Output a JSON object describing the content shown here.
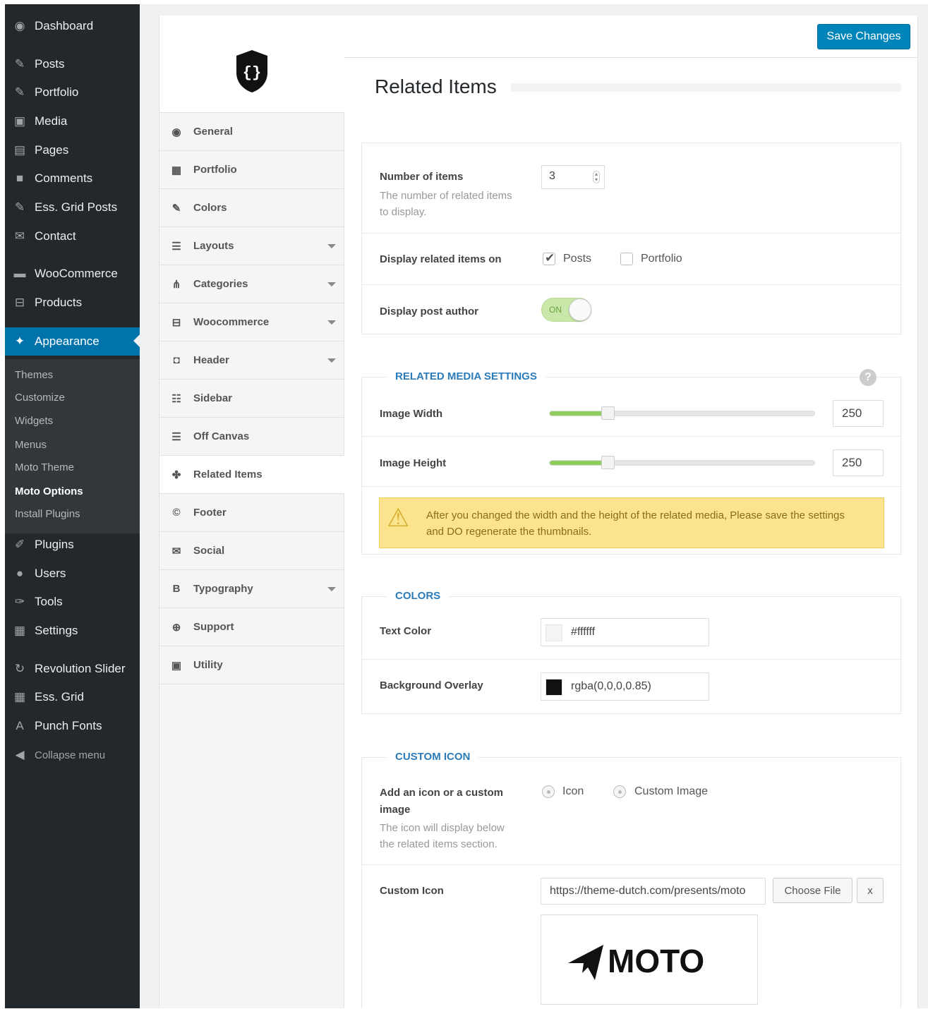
{
  "wp_menu": {
    "items": [
      {
        "label": "Dashboard",
        "icon": "dashboard-icon",
        "glyph": "◉"
      },
      {
        "label": "Posts",
        "icon": "pin-icon",
        "glyph": "✎"
      },
      {
        "label": "Portfolio",
        "icon": "pin-icon",
        "glyph": "✎"
      },
      {
        "label": "Media",
        "icon": "media-icon",
        "glyph": "▣"
      },
      {
        "label": "Pages",
        "icon": "pages-icon",
        "glyph": "▤"
      },
      {
        "label": "Comments",
        "icon": "comments-icon",
        "glyph": "■"
      },
      {
        "label": "Ess. Grid Posts",
        "icon": "pin-icon",
        "glyph": "✎"
      },
      {
        "label": "Contact",
        "icon": "mail-icon",
        "glyph": "✉"
      },
      {
        "label": "WooCommerce",
        "icon": "woo-icon",
        "glyph": "▬"
      },
      {
        "label": "Products",
        "icon": "cart-icon",
        "glyph": "⊟"
      },
      {
        "label": "Appearance",
        "icon": "brush-icon",
        "glyph": "✦"
      },
      {
        "label": "Plugins",
        "icon": "plug-icon",
        "glyph": "✐"
      },
      {
        "label": "Users",
        "icon": "user-icon",
        "glyph": "●"
      },
      {
        "label": "Tools",
        "icon": "wrench-icon",
        "glyph": "✑"
      },
      {
        "label": "Settings",
        "icon": "settings-icon",
        "glyph": "▦"
      },
      {
        "label": "Revolution Slider",
        "icon": "refresh-icon",
        "glyph": "↻"
      },
      {
        "label": "Ess. Grid",
        "icon": "grid-icon",
        "glyph": "▦"
      },
      {
        "label": "Punch Fonts",
        "icon": "font-icon",
        "glyph": "A"
      }
    ],
    "submenu": [
      "Themes",
      "Customize",
      "Widgets",
      "Menus",
      "Moto Theme",
      "Moto Options",
      "Install Plugins"
    ],
    "collapse_label": "Collapse menu"
  },
  "options_nav": {
    "items": [
      {
        "label": "General",
        "glyph": "◉",
        "has_caret": false
      },
      {
        "label": "Portfolio",
        "glyph": "▦",
        "has_caret": false
      },
      {
        "label": "Colors",
        "glyph": "✎",
        "has_caret": false
      },
      {
        "label": "Layouts",
        "glyph": "☰",
        "has_caret": true
      },
      {
        "label": "Categories",
        "glyph": "⋔",
        "has_caret": true
      },
      {
        "label": "Woocommerce",
        "glyph": "⊟",
        "has_caret": true
      },
      {
        "label": "Header",
        "glyph": "◘",
        "has_caret": true
      },
      {
        "label": "Sidebar",
        "glyph": "☷",
        "has_caret": false
      },
      {
        "label": "Off Canvas",
        "glyph": "☰",
        "has_caret": false
      },
      {
        "label": "Related Items",
        "glyph": "✤",
        "has_caret": false
      },
      {
        "label": "Footer",
        "glyph": "©",
        "has_caret": false
      },
      {
        "label": "Social",
        "glyph": "✉",
        "has_caret": false
      },
      {
        "label": "Typography",
        "glyph": "B",
        "has_caret": true
      },
      {
        "label": "Support",
        "glyph": "⊕",
        "has_caret": false
      },
      {
        "label": "Utility",
        "glyph": "▣",
        "has_caret": false
      }
    ],
    "selected": "Related Items"
  },
  "header": {
    "save_label": "Save Changes",
    "page_title": "Related Items"
  },
  "general": {
    "num_items_label": "Number of items",
    "num_items_desc": "The number of related items to display.",
    "num_items_value": "3",
    "display_on_label": "Display related items on",
    "display_on_options": [
      {
        "label": "Posts",
        "checked": true
      },
      {
        "label": "Portfolio",
        "checked": false
      }
    ],
    "author_label": "Display post author",
    "author_toggle": "ON"
  },
  "media": {
    "heading": "RELATED MEDIA SETTINGS",
    "width_label": "Image Width",
    "width_value": "250",
    "width_fraction": 0.2,
    "height_label": "Image Height",
    "height_value": "250",
    "height_fraction": 0.2,
    "warning": "After you changed the width and the height of the related media, Please save the settings and DO regenerate the thumbnails."
  },
  "colors": {
    "heading": "COLORS",
    "text_label": "Text Color",
    "text_value": "#ffffff",
    "text_swatch": "#ffffff",
    "overlay_label": "Background Overlay",
    "overlay_value": "rgba(0,0,0,0.85)",
    "overlay_swatch": "#111111"
  },
  "custom_icon": {
    "heading": "CUSTOM ICON",
    "choice_label": "Add an icon or a custom image",
    "choice_desc": "The icon will display below the related items section.",
    "options": [
      "Icon",
      "Custom Image"
    ],
    "icon_label": "Custom Icon",
    "url_value": "https://theme-dutch.com/presents/moto",
    "choose_label": "Choose File",
    "remove_label": "x",
    "preview_text": "MOTO"
  },
  "colors_theme": {
    "accent": "#0085ba",
    "section_heading": "#2b7bb9",
    "slider_fill": "#8fce5e",
    "warning_bg": "#fce48e"
  }
}
